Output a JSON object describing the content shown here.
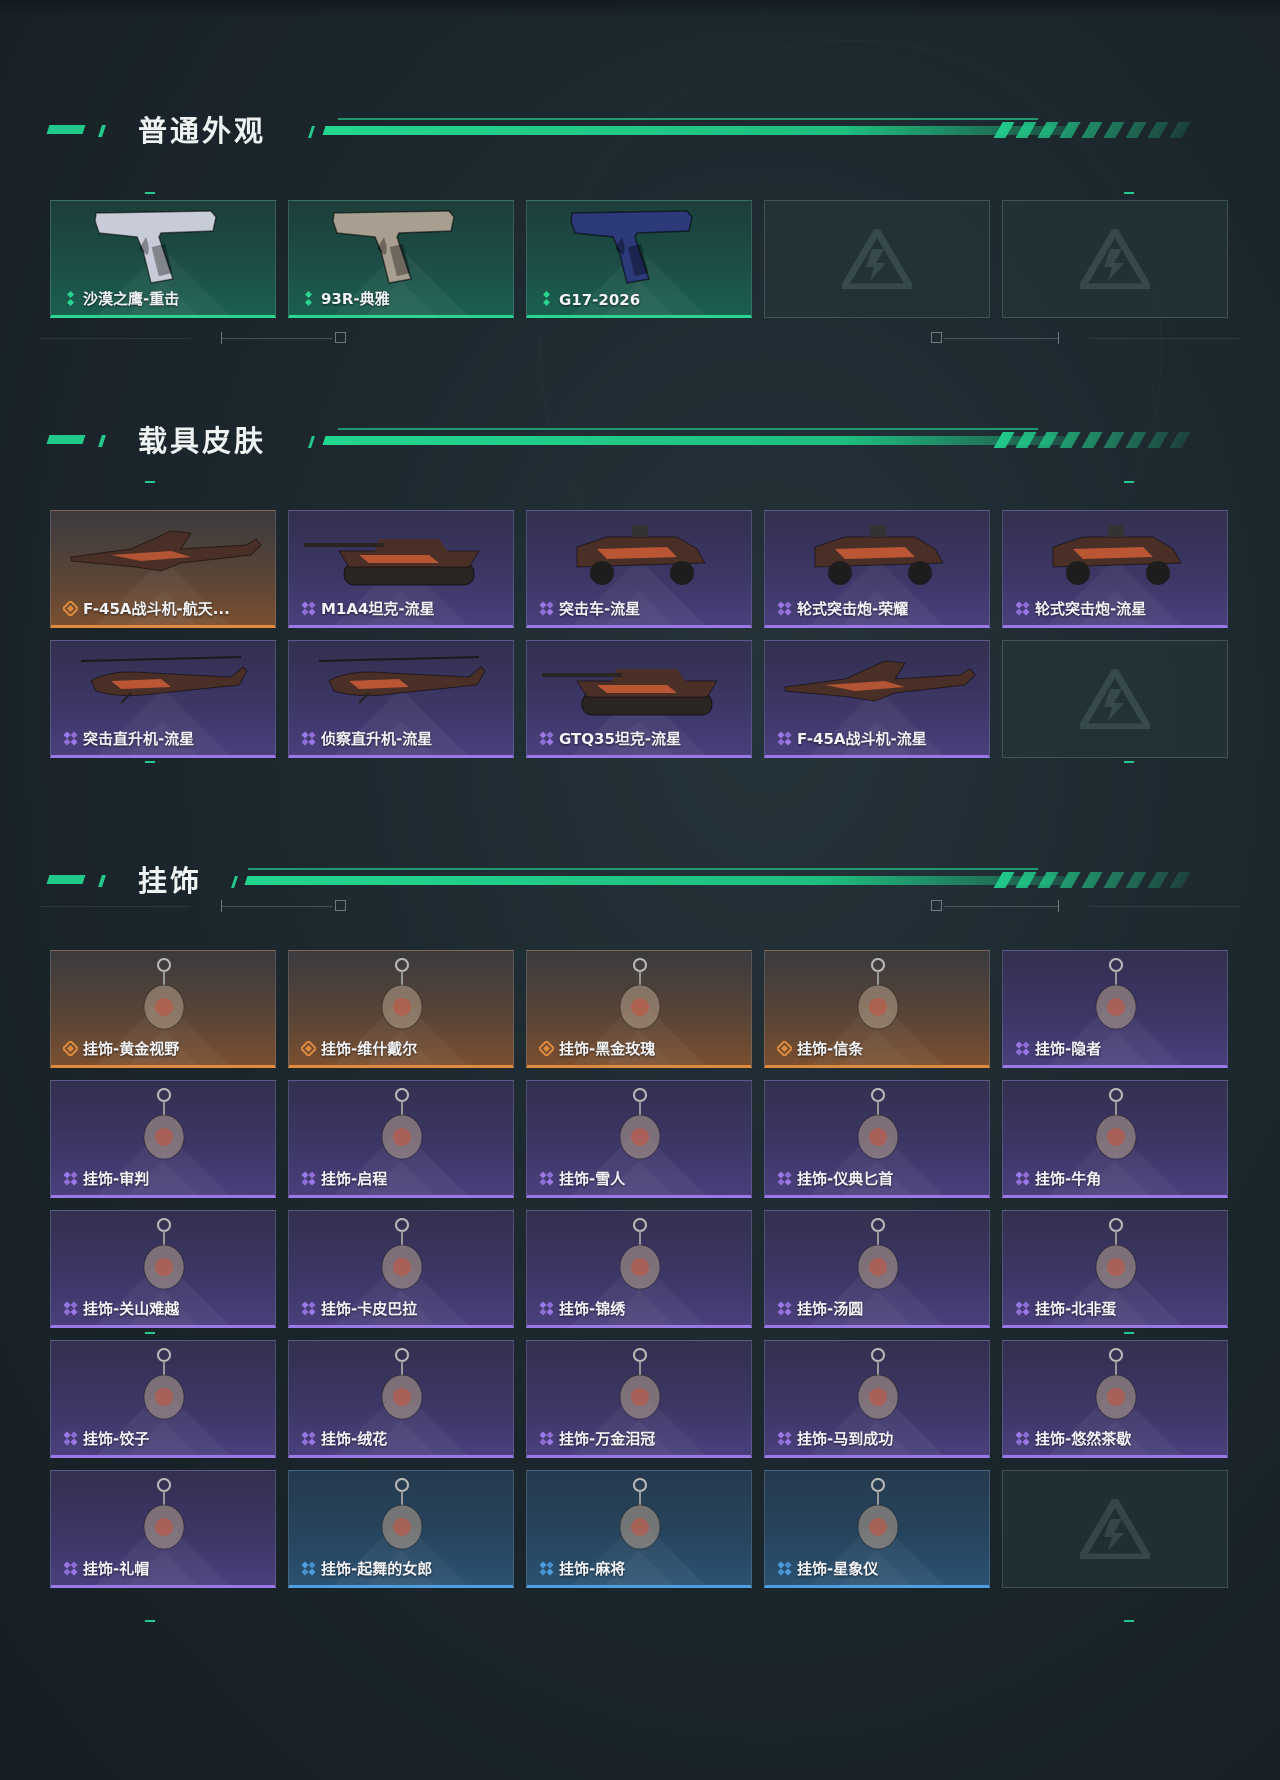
{
  "sections": {
    "weapons": {
      "title": "普通外观",
      "items": [
        {
          "label": "沙漠之鹰-重击",
          "rarity": "green"
        },
        {
          "label": "93R-典雅",
          "rarity": "green"
        },
        {
          "label": "G17-2026",
          "rarity": "green"
        }
      ]
    },
    "vehicles": {
      "title": "载具皮肤",
      "items": [
        {
          "label": "F-45A战斗机-航天...",
          "rarity": "orange"
        },
        {
          "label": "M1A4坦克-流星",
          "rarity": "purple"
        },
        {
          "label": "突击车-流星",
          "rarity": "purple"
        },
        {
          "label": "轮式突击炮-荣耀",
          "rarity": "purple"
        },
        {
          "label": "轮式突击炮-流星",
          "rarity": "purple"
        },
        {
          "label": "突击直升机-流星",
          "rarity": "purple"
        },
        {
          "label": "侦察直升机-流星",
          "rarity": "purple"
        },
        {
          "label": "GTQ35坦克-流星",
          "rarity": "purple"
        },
        {
          "label": "F-45A战斗机-流星",
          "rarity": "purple"
        }
      ]
    },
    "charms": {
      "title": "挂饰",
      "items": [
        {
          "label": "挂饰-黄金视野",
          "rarity": "orange"
        },
        {
          "label": "挂饰-维什戴尔",
          "rarity": "orange"
        },
        {
          "label": "挂饰-黑金玫瑰",
          "rarity": "orange"
        },
        {
          "label": "挂饰-信条",
          "rarity": "orange"
        },
        {
          "label": "挂饰-隐者",
          "rarity": "purple"
        },
        {
          "label": "挂饰-审判",
          "rarity": "purple"
        },
        {
          "label": "挂饰-启程",
          "rarity": "purple"
        },
        {
          "label": "挂饰-雪人",
          "rarity": "purple"
        },
        {
          "label": "挂饰-仪典匕首",
          "rarity": "purple"
        },
        {
          "label": "挂饰-牛角",
          "rarity": "purple"
        },
        {
          "label": "挂饰-关山难越",
          "rarity": "purple"
        },
        {
          "label": "挂饰-卡皮巴拉",
          "rarity": "purple"
        },
        {
          "label": "挂饰-锦绣",
          "rarity": "purple"
        },
        {
          "label": "挂饰-汤圆",
          "rarity": "purple"
        },
        {
          "label": "挂饰-北非蛋",
          "rarity": "purple"
        },
        {
          "label": "挂饰-饺子",
          "rarity": "purple"
        },
        {
          "label": "挂饰-绒花",
          "rarity": "purple"
        },
        {
          "label": "挂饰-万金泪冠",
          "rarity": "purple"
        },
        {
          "label": "挂饰-马到成功",
          "rarity": "purple"
        },
        {
          "label": "挂饰-悠然茶歇",
          "rarity": "purple"
        },
        {
          "label": "挂饰-礼帽",
          "rarity": "purple"
        },
        {
          "label": "挂饰-起舞的女郎",
          "rarity": "blue"
        },
        {
          "label": "挂饰-麻将",
          "rarity": "blue"
        },
        {
          "label": "挂饰-星象仪",
          "rarity": "blue"
        }
      ]
    }
  },
  "colors": {
    "accent": "#22c98a",
    "green": "#29d58f",
    "orange": "#e08a3e",
    "purple": "#9b78e8",
    "blue": "#4e9ee2"
  }
}
